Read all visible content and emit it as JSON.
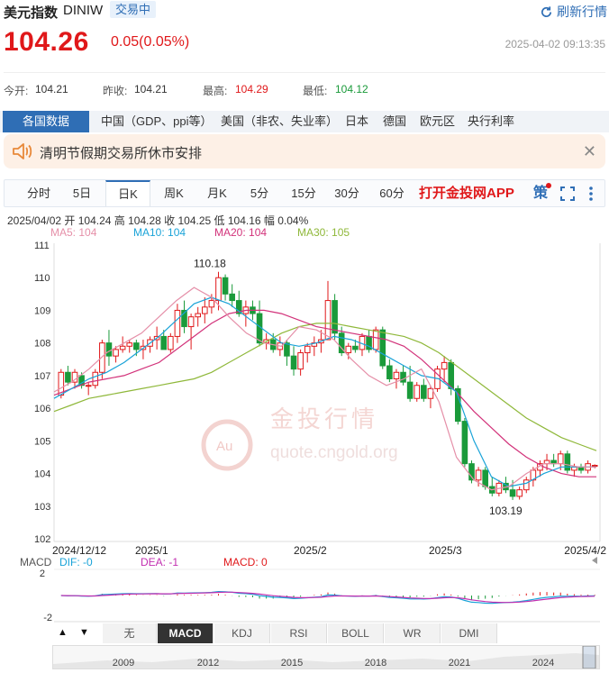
{
  "header": {
    "name": "美元指数",
    "code": "DINIW",
    "status_badge": "交易中",
    "refresh_label": "刷新行情"
  },
  "quote": {
    "price": "104.26",
    "change": "0.05(0.05%)",
    "timestamp": "2025-04-02 09:13:35"
  },
  "stats": {
    "open_label": "今开:",
    "open": "104.21",
    "prev_label": "昨收:",
    "prev": "104.21",
    "high_label": "最高:",
    "high": "104.29",
    "low_label": "最低:",
    "low": "104.12"
  },
  "tabs": [
    {
      "label": "各国数据",
      "active": true
    },
    {
      "label": "中国（GDP、ppi等）"
    },
    {
      "label": "美国（非农、失业率）"
    },
    {
      "label": "日本"
    },
    {
      "label": "德国"
    },
    {
      "label": "欧元区"
    },
    {
      "label": "央行利率"
    }
  ],
  "notice": {
    "text": "清明节假期交易所休市安排"
  },
  "periods": [
    {
      "label": "分时"
    },
    {
      "label": "5日"
    },
    {
      "label": "日K",
      "active": true
    },
    {
      "label": "周K"
    },
    {
      "label": "月K"
    },
    {
      "label": "5分"
    },
    {
      "label": "15分"
    },
    {
      "label": "30分"
    },
    {
      "label": "60分"
    }
  ],
  "app_link": "打开金投网APP",
  "strategy_label": "策",
  "candle_info": "2025/04/02 开 104.24 高 104.28 收 104.25 低 104.16 幅 0.04%",
  "ma_labels": [
    {
      "text": "MA5: 104",
      "color": "#e58fa8"
    },
    {
      "text": "MA10: 104",
      "color": "#1aa3d8"
    },
    {
      "text": "MA20: 104",
      "color": "#d2327a"
    },
    {
      "text": "MA30: 105",
      "color": "#8fb83a"
    }
  ],
  "watermark": {
    "cn": "金投行情",
    "url": "quote.cngold.org",
    "logo": "Au"
  },
  "colors": {
    "up": "#e0181a",
    "down": "#1a9a3a",
    "accent": "#2f6eb5"
  },
  "chart_data": {
    "type": "candlestick",
    "ylim": [
      102,
      111
    ],
    "yticks": [
      "111",
      "110",
      "109",
      "108",
      "107",
      "106",
      "105",
      "104",
      "103",
      "102"
    ],
    "xticks": [
      "2024/12/12",
      "2025/1",
      "2025/2",
      "2025/3",
      "2025/4/2"
    ],
    "annotations": [
      "110.18",
      "103.19"
    ],
    "ohlc": [
      [
        106.4,
        107.2,
        106.3,
        107.1
      ],
      [
        107.1,
        107.3,
        106.7,
        106.8
      ],
      [
        106.8,
        107.2,
        106.6,
        107.1
      ],
      [
        107.0,
        107.1,
        106.6,
        106.7
      ],
      [
        106.7,
        106.8,
        106.4,
        106.7
      ],
      [
        106.7,
        107.2,
        106.6,
        107.1
      ],
      [
        107.1,
        108.1,
        106.9,
        108.0
      ],
      [
        108.0,
        108.4,
        107.3,
        107.6
      ],
      [
        107.6,
        107.9,
        107.4,
        107.8
      ],
      [
        107.8,
        108.2,
        107.7,
        107.9
      ],
      [
        107.9,
        108.1,
        107.7,
        108.0
      ],
      [
        108.0,
        108.1,
        107.6,
        107.8
      ],
      [
        107.8,
        108.1,
        107.5,
        107.9
      ],
      [
        107.9,
        108.2,
        107.7,
        108.1
      ],
      [
        108.1,
        108.5,
        107.8,
        108.2
      ],
      [
        108.2,
        108.4,
        107.8,
        107.8
      ],
      [
        107.8,
        108.3,
        107.7,
        108.2
      ],
      [
        108.2,
        109.2,
        108.0,
        109.0
      ],
      [
        109.0,
        109.3,
        108.3,
        108.5
      ],
      [
        108.5,
        108.9,
        107.8,
        108.8
      ],
      [
        108.8,
        109.1,
        108.5,
        108.9
      ],
      [
        108.9,
        109.4,
        108.6,
        109.1
      ],
      [
        109.1,
        109.5,
        108.9,
        109.3
      ],
      [
        109.3,
        110.18,
        109.0,
        110.0
      ],
      [
        110.0,
        110.1,
        109.3,
        109.5
      ],
      [
        109.5,
        109.8,
        109.1,
        109.3
      ],
      [
        109.3,
        109.6,
        108.8,
        108.9
      ],
      [
        108.9,
        109.3,
        108.5,
        109.1
      ],
      [
        109.1,
        109.3,
        108.7,
        108.9
      ],
      [
        108.9,
        109.3,
        107.9,
        108.0
      ],
      [
        108.0,
        108.3,
        107.8,
        108.1
      ],
      [
        108.1,
        108.3,
        107.7,
        107.8
      ],
      [
        107.8,
        108.2,
        107.6,
        108.0
      ],
      [
        108.0,
        108.1,
        107.3,
        107.6
      ],
      [
        107.6,
        107.9,
        107.0,
        107.2
      ],
      [
        107.2,
        107.8,
        107.0,
        107.7
      ],
      [
        107.7,
        108.0,
        107.4,
        107.9
      ],
      [
        107.9,
        108.2,
        107.6,
        108.0
      ],
      [
        108.0,
        108.4,
        107.7,
        108.1
      ],
      [
        108.1,
        109.9,
        108.1,
        109.3
      ],
      [
        109.3,
        109.5,
        108.1,
        108.3
      ],
      [
        108.3,
        108.5,
        107.6,
        107.7
      ],
      [
        107.7,
        108.0,
        107.5,
        107.9
      ],
      [
        107.9,
        108.1,
        107.7,
        107.8
      ],
      [
        107.8,
        108.3,
        107.6,
        108.2
      ],
      [
        108.2,
        108.4,
        107.7,
        107.8
      ],
      [
        107.8,
        108.5,
        107.7,
        108.4
      ],
      [
        108.4,
        108.5,
        107.2,
        107.3
      ],
      [
        107.3,
        107.5,
        106.8,
        106.9
      ],
      [
        106.9,
        107.2,
        106.6,
        107.1
      ],
      [
        107.1,
        107.3,
        106.7,
        106.8
      ],
      [
        106.8,
        107.3,
        106.2,
        106.3
      ],
      [
        106.3,
        106.8,
        106.2,
        106.7
      ],
      [
        106.7,
        106.9,
        106.2,
        106.3
      ],
      [
        106.3,
        106.7,
        106.0,
        106.6
      ],
      [
        106.6,
        107.3,
        106.5,
        107.2
      ],
      [
        107.2,
        107.6,
        106.8,
        107.4
      ],
      [
        107.4,
        107.5,
        106.4,
        106.6
      ],
      [
        106.6,
        106.7,
        105.5,
        105.6
      ],
      [
        105.6,
        105.7,
        104.2,
        104.3
      ],
      [
        104.3,
        104.4,
        103.7,
        103.8
      ],
      [
        103.8,
        104.2,
        103.6,
        104.1
      ],
      [
        104.1,
        104.2,
        103.5,
        103.6
      ],
      [
        103.6,
        103.9,
        103.3,
        103.4
      ],
      [
        103.4,
        103.8,
        103.3,
        103.7
      ],
      [
        103.7,
        103.9,
        103.4,
        103.5
      ],
      [
        103.5,
        103.8,
        103.19,
        103.3
      ],
      [
        103.3,
        103.6,
        103.2,
        103.5
      ],
      [
        103.5,
        103.9,
        103.4,
        103.8
      ],
      [
        103.8,
        104.2,
        103.6,
        104.1
      ],
      [
        104.1,
        104.4,
        103.9,
        104.3
      ],
      [
        104.3,
        104.6,
        104.1,
        104.4
      ],
      [
        104.4,
        104.6,
        104.2,
        104.3
      ],
      [
        104.3,
        104.7,
        104.1,
        104.6
      ],
      [
        104.6,
        104.7,
        104.0,
        104.1
      ],
      [
        104.1,
        104.3,
        103.9,
        104.2
      ],
      [
        104.2,
        104.3,
        104.0,
        104.1
      ],
      [
        104.1,
        104.4,
        104.0,
        104.3
      ],
      [
        104.24,
        104.28,
        104.16,
        104.25
      ]
    ],
    "ma_series": {
      "MA30": [
        105.9,
        106.1,
        106.3,
        106.4,
        106.5,
        106.6,
        106.7,
        106.8,
        106.9,
        107.1,
        107.4,
        107.7,
        108.0,
        108.3,
        108.5,
        108.6,
        108.6,
        108.5,
        108.4,
        108.3,
        108.2,
        108.0,
        107.7,
        107.3,
        106.9,
        106.5,
        106.1,
        105.7,
        105.4,
        105.1,
        104.9,
        104.7
      ],
      "MA20": [
        106.4,
        106.6,
        106.8,
        106.9,
        107.0,
        107.2,
        107.4,
        107.8,
        108.2,
        108.6,
        108.9,
        109.0,
        109.0,
        108.9,
        108.7,
        108.5,
        108.4,
        108.3,
        108.2,
        108.1,
        107.9,
        107.5,
        107.0,
        106.5,
        105.9,
        105.4,
        104.9,
        104.5,
        104.2,
        104.0,
        103.9,
        103.9
      ],
      "MA10": [
        106.3,
        106.6,
        106.9,
        107.1,
        107.4,
        107.8,
        108.2,
        108.7,
        109.2,
        109.4,
        109.2,
        108.8,
        108.4,
        108.0,
        107.9,
        108.0,
        108.2,
        108.1,
        107.9,
        107.6,
        107.3,
        107.0,
        106.9,
        106.5,
        105.0,
        103.9,
        103.6,
        103.7,
        104.0,
        104.2,
        104.2,
        104.2
      ],
      "MA5": [
        106.5,
        106.8,
        107.2,
        107.7,
        108.0,
        108.3,
        108.8,
        109.3,
        109.7,
        109.4,
        108.8,
        108.3,
        108.0,
        107.9,
        108.5,
        108.4,
        108.1,
        107.5,
        107.0,
        106.7,
        106.9,
        107.2,
        106.2,
        104.5,
        103.8,
        103.5,
        103.6,
        104.0,
        104.3,
        104.3,
        104.2,
        104.2
      ]
    }
  },
  "macd": {
    "labels": [
      {
        "text": "MACD",
        "color": "#555"
      },
      {
        "text": "DIF: -0",
        "color": "#1aa3d8"
      },
      {
        "text": "DEA: -1",
        "color": "#c22fb0"
      },
      {
        "text": "MACD: 0",
        "color": "#e0181a"
      }
    ],
    "yticks": [
      "2",
      "-2"
    ],
    "tabs": [
      {
        "label": "无"
      },
      {
        "label": "MACD",
        "active": true
      },
      {
        "label": "KDJ"
      },
      {
        "label": "RSI"
      },
      {
        "label": "BOLL"
      },
      {
        "label": "WR"
      },
      {
        "label": "DMI"
      }
    ]
  },
  "minimap_years": [
    "2009",
    "2012",
    "2015",
    "2018",
    "2021",
    "2024"
  ]
}
